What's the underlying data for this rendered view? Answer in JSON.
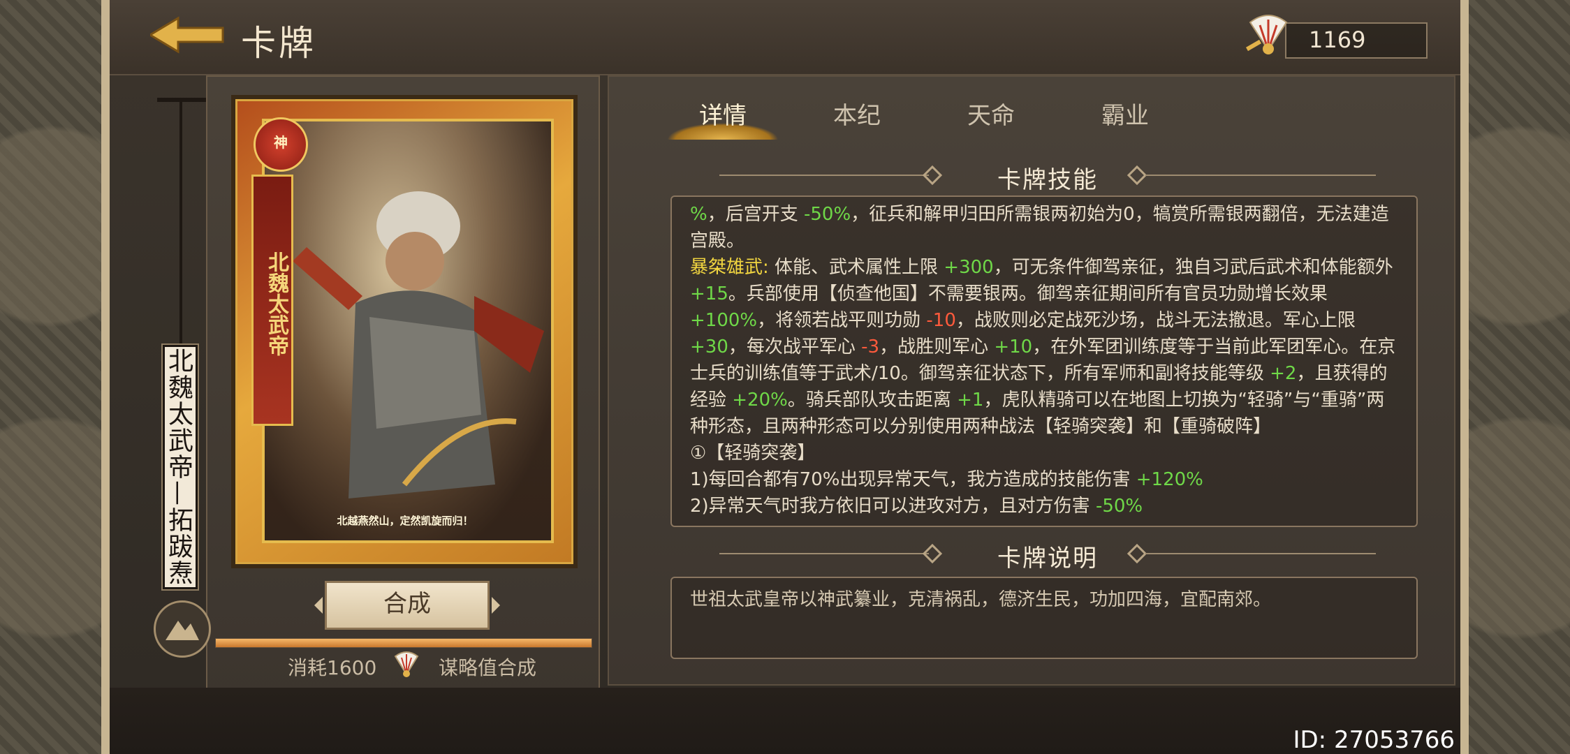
{
  "header": {
    "title": "卡牌",
    "currency_value": "1169"
  },
  "card": {
    "vertical_name": "北魏太武帝—拓跋焘",
    "banner_text": "北魏太武帝",
    "name_text": "拓跋焘",
    "badge_text": "神",
    "quote": "北越燕然山，定然凯旋而归！"
  },
  "actions": {
    "synthesize_label": "合成",
    "cost_prefix": "消耗1600",
    "cost_suffix": "谋略值合成",
    "progress": 1.0
  },
  "tabs": [
    {
      "label": "详情",
      "active": true
    },
    {
      "label": "本纪",
      "active": false
    },
    {
      "label": "天命",
      "active": false
    },
    {
      "label": "霸业",
      "active": false
    }
  ],
  "sections": {
    "skills_title": "卡牌技能",
    "desc_title": "卡牌说明"
  },
  "skills": {
    "line1_a": "%",
    "line1_b": "，后宫开支 ",
    "line1_c": "-50%",
    "line1_d": "，征兵和解甲归田所需银两初始为0，犒赏所需银两翻倍，无法建造宫殿。",
    "skill_name": "暴桀雄武:",
    "p2_a": " 体能、武术属性上限 ",
    "p2_b": "+300",
    "p2_c": "，可无条件御驾亲征，独自习武后武术和体能额外",
    "p2_d": "+15",
    "p2_e": "。兵部使用【侦查他国】不需要银两。御驾亲征期间所有官员功勋增长效果",
    "p2_f": "+100%",
    "p2_g": "，将领若战平则功勋 ",
    "p2_h": "-10",
    "p2_i": "，战败则必定战死沙场，战斗无法撤退。军心上限",
    "p2_j": "+30",
    "p2_k": "，每次战平军心 ",
    "p2_l": "-3",
    "p2_m": "，战胜则军心 ",
    "p2_n": "+10",
    "p2_o": "，在外军团训练度等于当前此军团军心。在京士兵的训练值等于武术/10。御驾亲征状态下，所有军师和副将技能等级 ",
    "p2_p": "+2",
    "p2_q": "，且获得的经验 ",
    "p2_r": "+20%",
    "p2_s": "。骑兵部队攻击距离 ",
    "p2_t": "+1",
    "p2_u": "，虎队精骑可以在地图上切换为“轻骑”与“重骑”两种形态，且两种形态可以分别使用两种战法【轻骑突袭】和【重骑破阵】",
    "p3": "①【轻骑突袭】",
    "p4_a": "1)每回合都有70%出现异常天气，我方造成的技能伤害 ",
    "p4_b": "+120%",
    "p5_a": "2)异常天气时我方依旧可以进攻对方，且对方伤害 ",
    "p5_b": "-50%"
  },
  "description": "世祖太武皇帝以神武纂业，克清祸乱，德济生民，功加四海，宜配南郊。",
  "footer": {
    "id_text": "ID: 27053766"
  },
  "colors": {
    "accent_gold": "#e4b44e",
    "positive": "#6fd848",
    "negative": "#ff5a3c",
    "skill_name": "#f2d640"
  }
}
